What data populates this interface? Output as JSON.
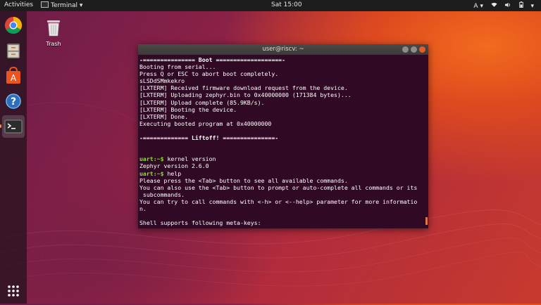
{
  "topbar": {
    "activities": "Activities",
    "app_menu": "Terminal",
    "clock": "Sat 15:00",
    "input_indicator": "A"
  },
  "desktop": {
    "trash_label": "Trash"
  },
  "dock": {
    "items": [
      "chrome",
      "files",
      "software",
      "help",
      "terminal"
    ],
    "active": "terminal"
  },
  "terminal": {
    "title": "user@riscv: ~",
    "lines": [
      {
        "text": "-=============== Boot ===================-",
        "style": "banner"
      },
      {
        "text": "Booting from serial...",
        "style": ""
      },
      {
        "text": "Press Q or ESC to abort boot completely.",
        "style": ""
      },
      {
        "text": "sLSDdSMmkekro",
        "style": ""
      },
      {
        "text": "[LXTERM] Received firmware download request from the device.",
        "style": ""
      },
      {
        "text": "[LXTERM] Uploading zephyr.bin to 0x40000000 (171384 bytes)...",
        "style": ""
      },
      {
        "text": "[LXTERM] Upload complete (85.9KB/s).",
        "style": ""
      },
      {
        "text": "[LXTERM] Booting the device.",
        "style": ""
      },
      {
        "text": "[LXTERM] Done.",
        "style": ""
      },
      {
        "text": "Executing booted program at 0x40000000",
        "style": ""
      },
      {
        "text": "",
        "style": ""
      },
      {
        "text": "-============= Liftoff! ===============-",
        "style": "banner"
      },
      {
        "text": "",
        "style": ""
      },
      {
        "text": "",
        "style": ""
      },
      {
        "prompt": "uart:~$",
        "text": " kernel version",
        "style": "prompt"
      },
      {
        "text": "Zephyr version 2.6.0",
        "style": ""
      },
      {
        "prompt": "uart:~$",
        "text": " help",
        "style": "prompt"
      },
      {
        "text": "Please press the <Tab> button to see all available commands.",
        "style": ""
      },
      {
        "text": "You can also use the <Tab> button to prompt or auto-complete all commands or its",
        "style": ""
      },
      {
        "text": " subcommands.",
        "style": ""
      },
      {
        "text": "You can try to call commands with <-h> or <--help> parameter for more informatio",
        "style": ""
      },
      {
        "text": "n.",
        "style": ""
      },
      {
        "text": "",
        "style": ""
      },
      {
        "text": "Shell supports following meta-keys:",
        "style": ""
      }
    ]
  },
  "colors": {
    "terminal_bg": "#300a24",
    "prompt": "#8ae234",
    "accent": "#f4913a"
  }
}
